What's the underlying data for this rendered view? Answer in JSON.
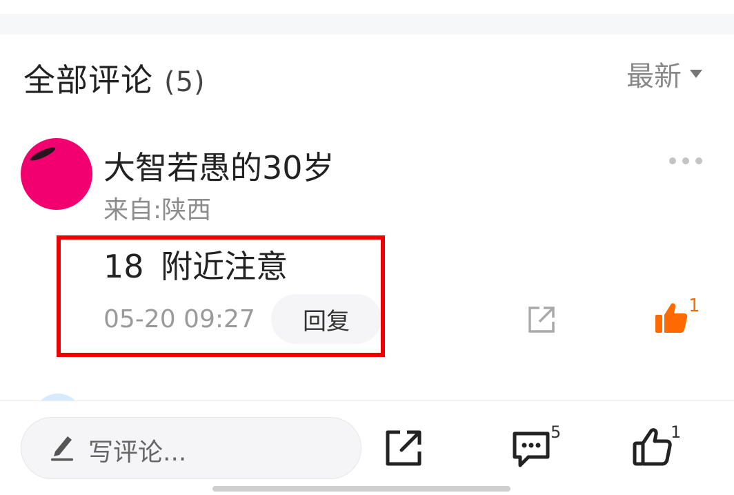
{
  "header": {
    "title": "全部评论",
    "count": "(5)",
    "sort_label": "最新"
  },
  "comment": {
    "username": "大智若愚的30岁",
    "location": "来自:陕西",
    "text": "18  附近注意",
    "timestamp": "05-20 09:27",
    "reply_label": "回复",
    "like_count": "1"
  },
  "bottom_bar": {
    "input_placeholder": "写评论...",
    "comment_count": "5",
    "like_count": "1"
  },
  "colors": {
    "highlight": "#ee0000",
    "like_active": "#ff6a00",
    "avatar": "#f2006f"
  },
  "icons": {
    "sort": "caret-down-icon",
    "more": "more-horizontal-icon",
    "share": "share-external-icon",
    "like_active": "thumbs-up-filled-icon",
    "pencil": "pencil-icon",
    "comment": "comment-bubble-icon",
    "like": "thumbs-up-outline-icon"
  }
}
